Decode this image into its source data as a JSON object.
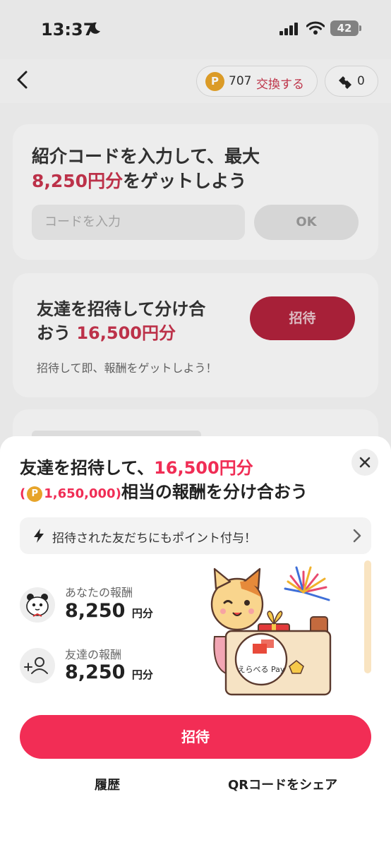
{
  "status": {
    "time": "13:37",
    "battery": "42"
  },
  "header": {
    "points": "707",
    "exchange_label": "交換する",
    "tickets": "0",
    "coin_glyph": "P"
  },
  "code_card": {
    "title_line1": "紹介コードを入力して、最大",
    "title_highlight": "8,250円分",
    "title_rest": "をゲットしよう",
    "input_placeholder": "コードを入力",
    "ok_label": "OK"
  },
  "invite_card": {
    "title_line1": "友達を招待して分け合",
    "title_line2_prefix": "おう ",
    "title_highlight": "16,500円分",
    "button_label": "招待",
    "subtitle": "招待して即、報酬をゲットしよう！"
  },
  "sheet": {
    "title_prefix": "友達を招待して、",
    "title_highlight": "16,500円分",
    "paren_open": "(",
    "points_amount": "1,650,000",
    "paren_close": ")",
    "title_rest": "相当の報酬を分け合おう",
    "notice": "招待された友だちにもポイント付与！",
    "your_reward_label": "あなたの報酬",
    "your_reward_value": "8,250",
    "friend_reward_label": "友達の報酬",
    "friend_reward_value": "8,250",
    "unit": "円分",
    "pay_logo_text": "えらべる Pay",
    "invite_button": "招待",
    "history_link": "履歴",
    "qr_share_link": "QRコードをシェア"
  },
  "colors": {
    "accent": "#f22d55",
    "coin": "#e7a42a"
  }
}
